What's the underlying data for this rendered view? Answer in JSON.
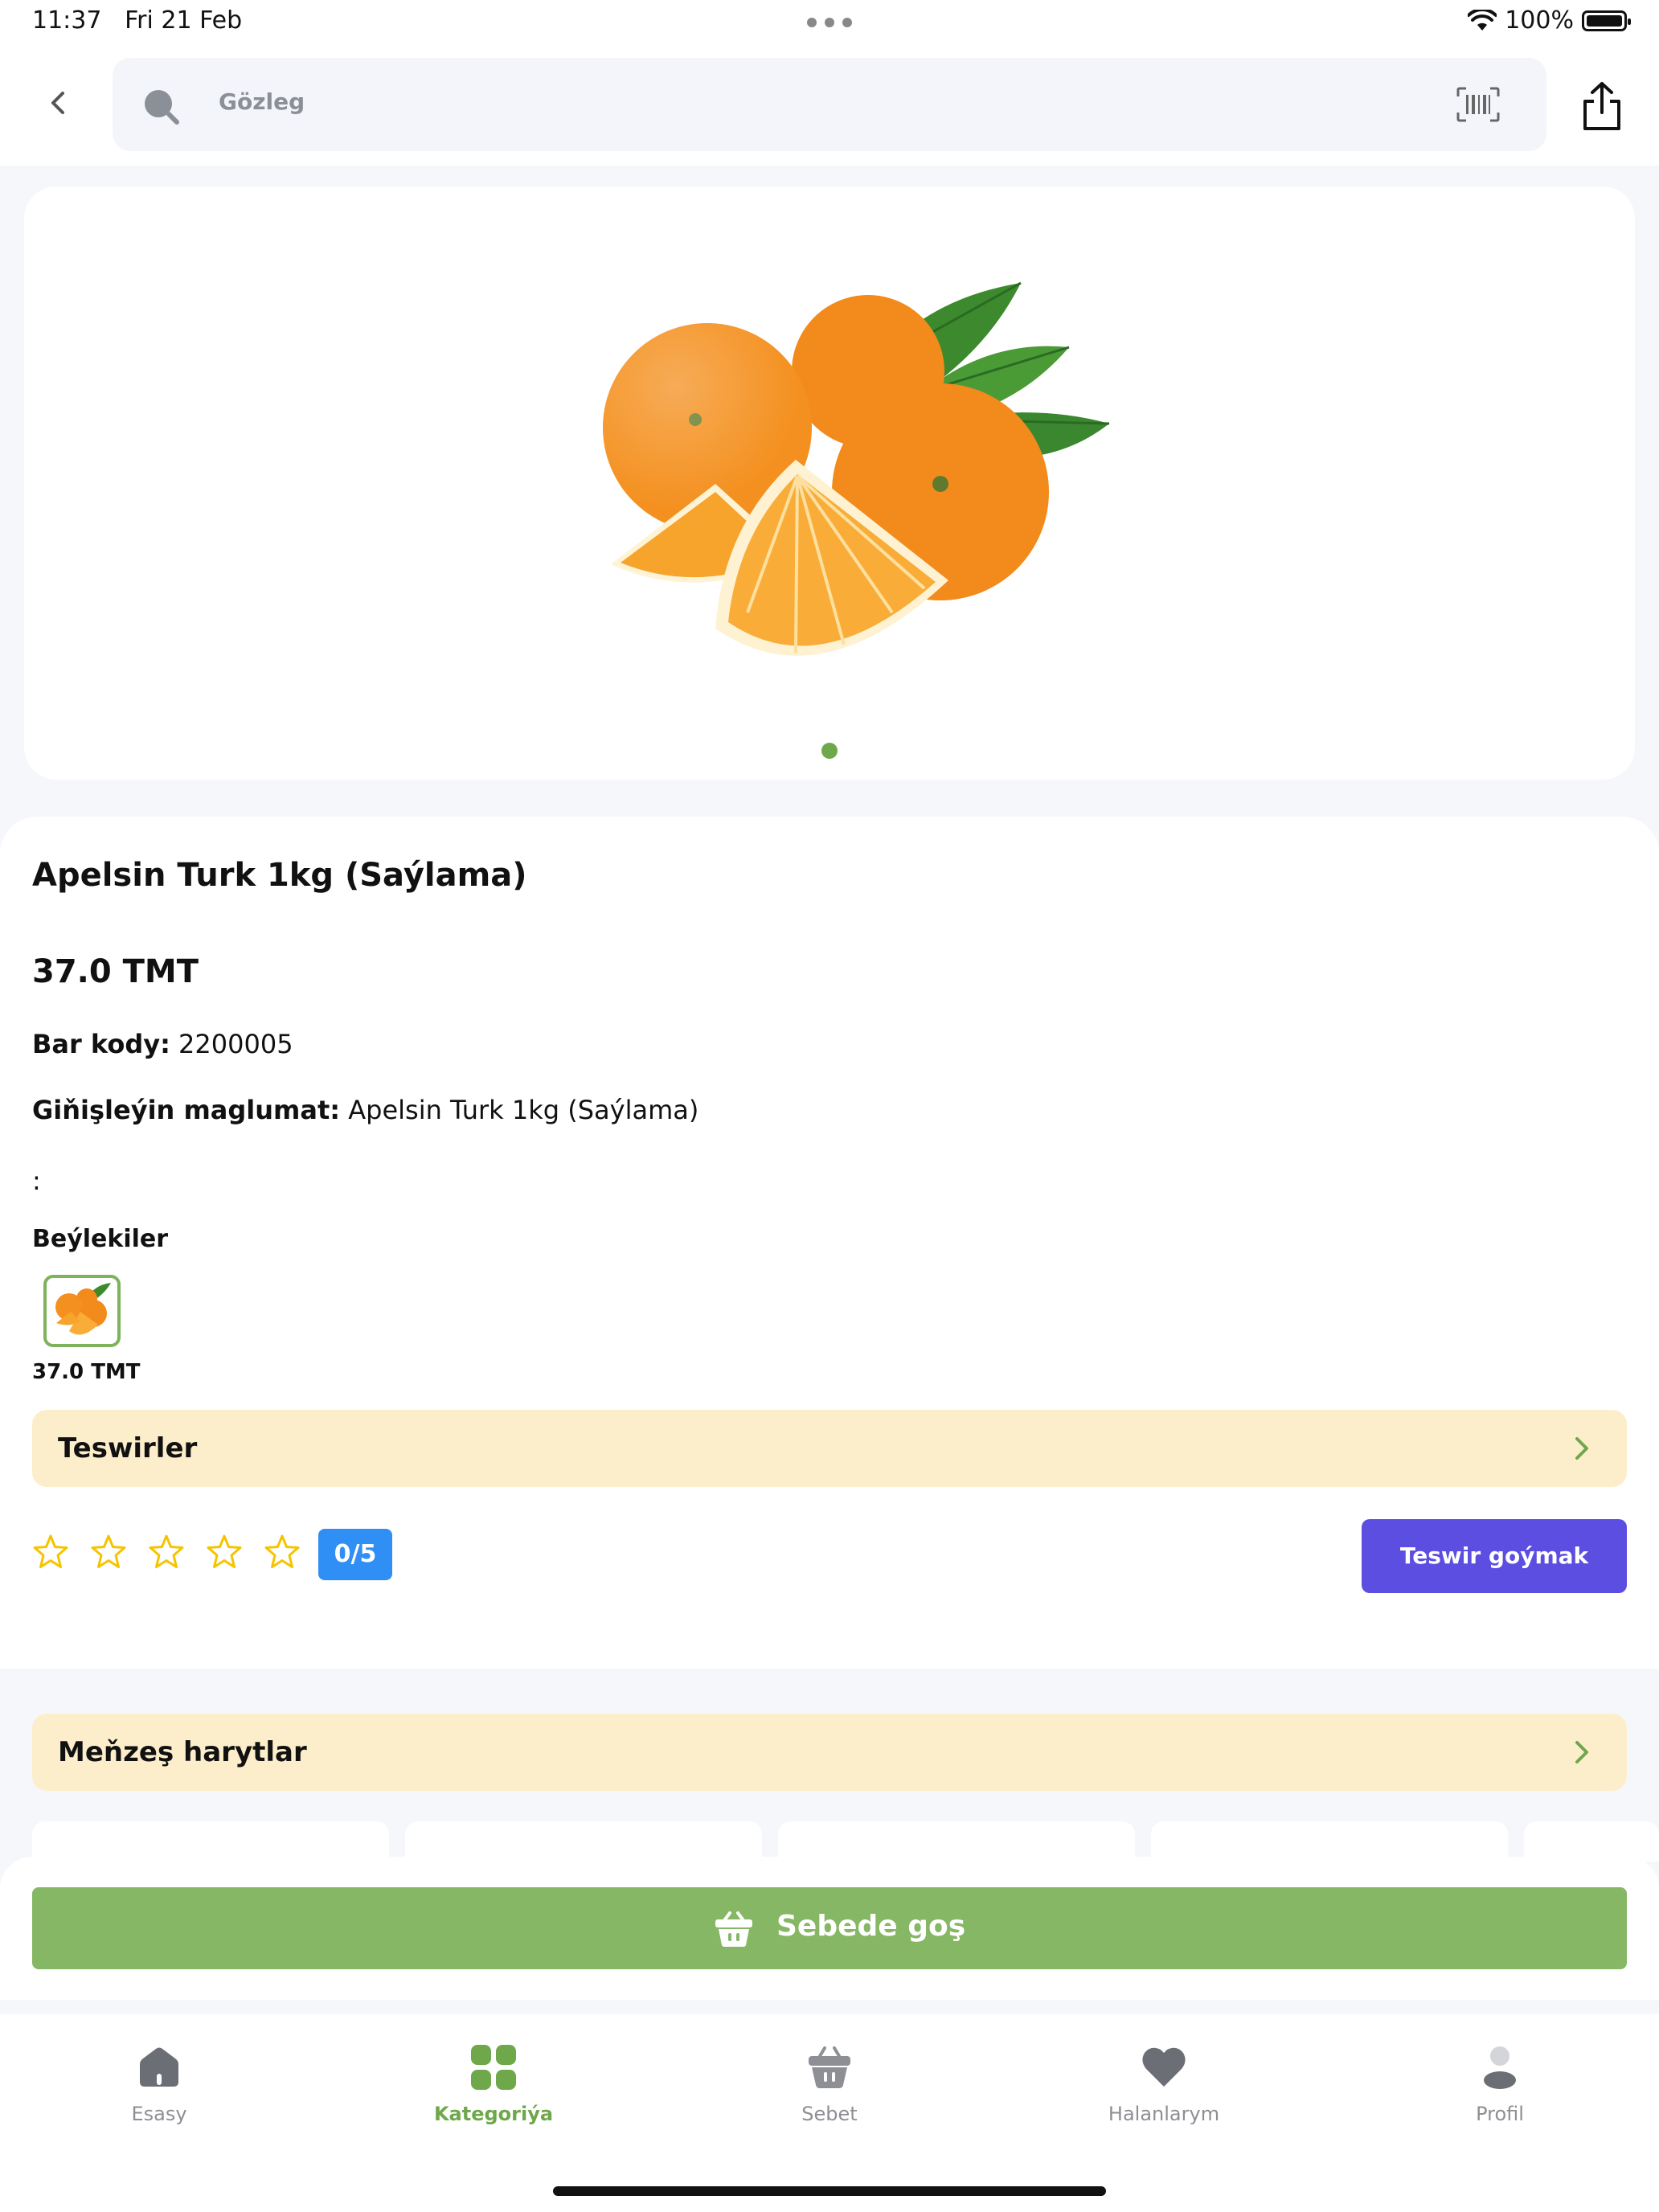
{
  "status": {
    "time": "11:37",
    "date": "Fri 21 Feb",
    "battery": "100%"
  },
  "search": {
    "placeholder": "Gözleg"
  },
  "product": {
    "title": "Apelsin Turk 1kg (Saýlama)",
    "price": "37.0 TMT",
    "barcode_label": "Bar kody:",
    "barcode_value": "2200005",
    "details_label": "Giňişleýin maglumat:",
    "details_value": "Apelsin Turk 1kg (Saýlama)",
    "extra": ":",
    "variants_label": "Beýlekiler",
    "variants": [
      {
        "price": "37.0 TMT"
      }
    ]
  },
  "reviews": {
    "section_label": "Teswirler",
    "rating": "0/5",
    "stars": 5,
    "add_review_label": "Teswir goýmak"
  },
  "similar": {
    "section_label": "Meňzeş harytlar"
  },
  "cart": {
    "add_label": "Sebede goş"
  },
  "tabs": [
    {
      "label": "Esasy",
      "icon": "home-icon",
      "active": false
    },
    {
      "label": "Kategoriýa",
      "icon": "grid-icon",
      "active": true
    },
    {
      "label": "Sebet",
      "icon": "basket-icon",
      "active": false
    },
    {
      "label": "Halanlarym",
      "icon": "heart-icon",
      "active": false
    },
    {
      "label": "Profil",
      "icon": "profile-icon",
      "active": false
    }
  ],
  "colors": {
    "accent_green": "#86b764",
    "review_button": "#5b4ee0",
    "rating_badge": "#2f8ff5",
    "section_bg": "#fdeecb"
  }
}
